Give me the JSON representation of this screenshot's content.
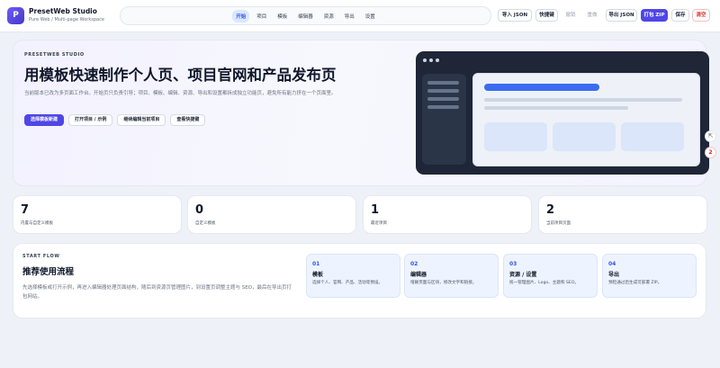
{
  "app": {
    "logo_letter": "P",
    "name": "PresetWeb Studio",
    "subtitle": "Pure Web / Multi-page Workspace"
  },
  "nav": {
    "tabs": [
      {
        "label": "开始",
        "active": true
      },
      {
        "label": "项目"
      },
      {
        "label": "模板"
      },
      {
        "label": "编辑器"
      },
      {
        "label": "资源"
      },
      {
        "label": "导出"
      },
      {
        "label": "设置"
      }
    ]
  },
  "toolbar": {
    "import_json": "导入 JSON",
    "shortcuts": "快捷键",
    "undo": "撤销",
    "redo": "重做",
    "export_json": "导出 JSON",
    "pack_zip": "打包 ZIP",
    "save": "保存",
    "clear": "清空"
  },
  "hero": {
    "eyebrow": "PRESETWEB STUDIO",
    "title": "用模板快速制作个人页、项目官网和产品发布页",
    "description": "当前版本已改为多页面工作台。开始页只负责引导；项目、模板、编辑、资源、导出和设置都拆成独立功能页，避免所有能力挤在一个页面里。",
    "buttons": {
      "choose_template": "选择模板新建",
      "open_project": "打开项目 / 示例",
      "continue_edit": "继续编辑当前项目",
      "view_shortcuts": "查看快捷键"
    }
  },
  "float": {
    "chip1": "⇱",
    "chip2": "2"
  },
  "stats": [
    {
      "value": "7",
      "label": "内置与自定义模板"
    },
    {
      "value": "0",
      "label": "自定义模板"
    },
    {
      "value": "1",
      "label": "最近项目"
    },
    {
      "value": "2",
      "label": "当前项目页面"
    }
  ],
  "flow": {
    "eyebrow": "START FLOW",
    "title": "推荐使用流程",
    "description": "先选择模板或打开示例，再进入编辑器处理页面结构，随后到资源页管理图片，到设置页调整主题与 SEO，最后在导出页打包网站。",
    "steps": [
      {
        "num": "01",
        "title": "模板",
        "desc": "选择个人、官网、产品、活动等预设。"
      },
      {
        "num": "02",
        "title": "编辑器",
        "desc": "增删页面与区块，修改文字和链接。"
      },
      {
        "num": "03",
        "title": "资源 / 设置",
        "desc": "统一管理图片、Logo、主题和 SEO。"
      },
      {
        "num": "04",
        "title": "导出",
        "desc": "预检通过后生成可部署 ZIP。"
      }
    ]
  },
  "colors": {
    "accent": "#4f46e5",
    "nav_active_bg": "#dbe7ff",
    "danger": "#dc2626"
  }
}
